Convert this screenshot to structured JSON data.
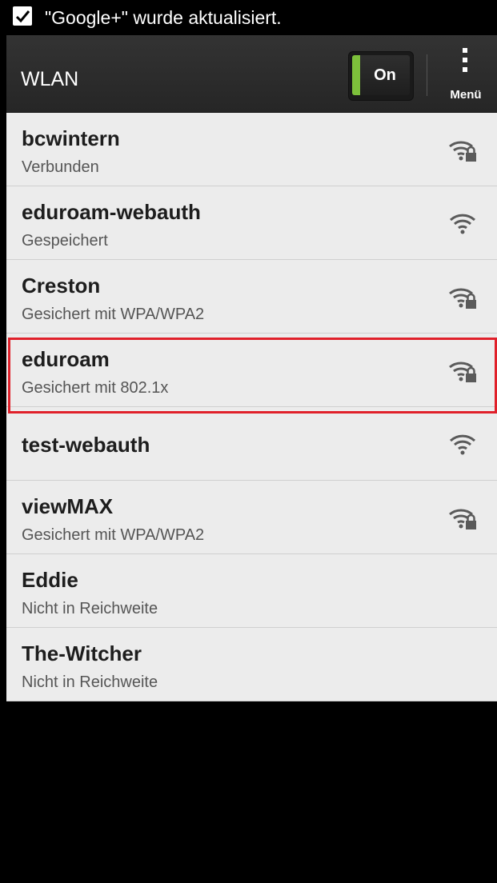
{
  "status_bar": {
    "notification_icon": "shopping-bag-check-icon",
    "notification_text": "\"Google+\" wurde aktualisiert."
  },
  "action_bar": {
    "title": "WLAN",
    "toggle_label": "On",
    "toggle_color": "#7dc03b",
    "menu_label": "Menü",
    "menu_icon": "overflow-dots-icon"
  },
  "networks": [
    {
      "name": "bcwintern",
      "status": "Verbunden",
      "signal_icon": "wifi-lock-icon"
    },
    {
      "name": "eduroam-webauth",
      "status": "Gespeichert",
      "signal_icon": "wifi-icon"
    },
    {
      "name": "Creston",
      "status": "Gesichert mit WPA/WPA2",
      "signal_icon": "wifi-lock-icon"
    },
    {
      "name": "eduroam",
      "status": "Gesichert mit 802.1x",
      "signal_icon": "wifi-lock-icon"
    },
    {
      "name": "test-webauth",
      "status": "",
      "signal_icon": "wifi-icon"
    },
    {
      "name": "viewMAX",
      "status": "Gesichert mit WPA/WPA2",
      "signal_icon": "wifi-lock-icon"
    },
    {
      "name": "Eddie",
      "status": "Nicht in Reichweite",
      "signal_icon": ""
    },
    {
      "name": "The-Witcher",
      "status": "Nicht in Reichweite",
      "signal_icon": ""
    }
  ],
  "highlight_color": "#e0202a"
}
